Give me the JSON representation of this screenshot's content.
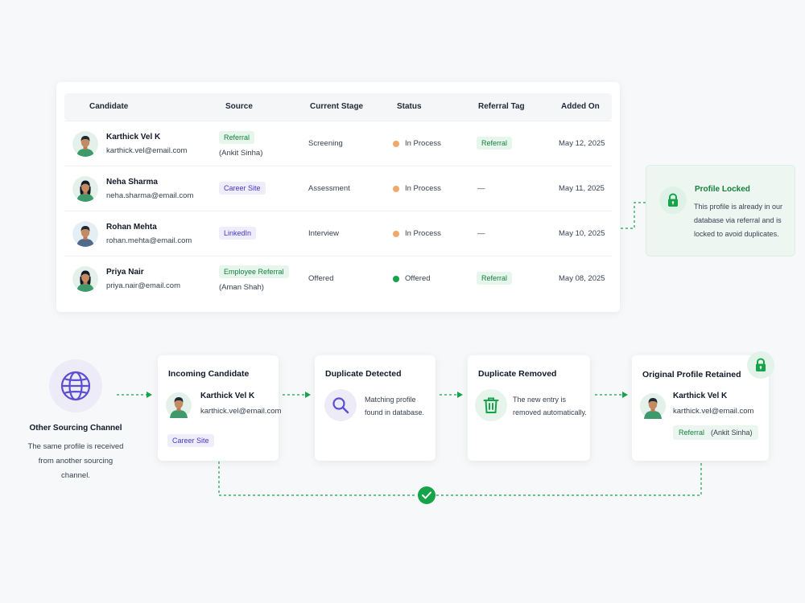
{
  "table": {
    "headers": [
      "Candidate",
      "Source",
      "Current Stage",
      "Status",
      "Referral Tag",
      "Added On"
    ],
    "rows": [
      {
        "name": "Karthick Vel K",
        "email": "karthick.vel@email.com",
        "source": "Referral",
        "source_sub": "(Ankit Sinha)",
        "stage": "Screening",
        "status": "In Process",
        "tag": "Referral",
        "added": "May 12, 2025"
      },
      {
        "name": "Neha Sharma",
        "email": "neha.sharma@email.com",
        "source": "Career Site",
        "source_sub": "",
        "stage": "Assessment",
        "status": "In Process",
        "tag": "—",
        "added": "May 11, 2025"
      },
      {
        "name": "Rohan Mehta",
        "email": "rohan.mehta@email.com",
        "source": "LinkedIn",
        "source_sub": "",
        "stage": "Interview",
        "status": "In Process",
        "tag": "—",
        "added": "May 10, 2025"
      },
      {
        "name": "Priya Nair",
        "email": "priya.nair@email.com",
        "source": "Employee Referral",
        "source_sub": "(Aman Shah)",
        "stage": "Offered",
        "status": "Offered",
        "tag": "Referral",
        "added": "May 08, 2025"
      }
    ]
  },
  "locked": {
    "title": "Profile Locked",
    "text": "This profile is already in our database via referral and is locked to avoid duplicates."
  },
  "flow": {
    "channel": {
      "title": "Other Sourcing Channel",
      "text": "The same profile is received from another sourcing channel."
    },
    "incoming": {
      "title": "Incoming Candidate",
      "name": "Karthick Vel K",
      "email": "karthick.vel@email.com",
      "chip": "Career Site"
    },
    "detected": {
      "title": "Duplicate Detected",
      "text": "Matching profile found in database."
    },
    "removed": {
      "title": "Duplicate Removed",
      "text": "The new entry is removed automatically."
    },
    "retained": {
      "title": "Original Profile Retained",
      "name": "Karthick Vel K",
      "email": "karthick.vel@email.com",
      "chip": "Referral",
      "chip_sub": "(Ankit Sinha)"
    }
  },
  "colors": {
    "accent_green": "#16a34a",
    "accent_purple": "#5b4fcf",
    "status_orange": "#f0a96b"
  }
}
